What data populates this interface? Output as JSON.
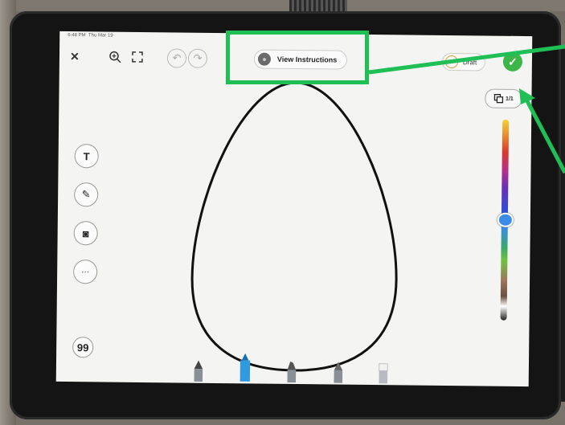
{
  "status_bar": {
    "time": "6:48 PM",
    "date": "Thu Mar 19"
  },
  "toolbar": {
    "instructions_label": "View Instructions",
    "draft_label": "Draft"
  },
  "page_indicator": "1/1",
  "side_tools": [
    {
      "icon": "text-icon",
      "glyph": "T"
    },
    {
      "icon": "pen-icon",
      "glyph": "✎"
    },
    {
      "icon": "camera-icon",
      "glyph": "◙"
    },
    {
      "icon": "more-icon",
      "glyph": "···"
    }
  ],
  "quote_glyph": "99",
  "colors": {
    "annotation_green": "#1fbf55",
    "done_green": "#3cb648",
    "selected_pen_blue": "#2f9ae0"
  },
  "canvas": {
    "shape": "egg-outline"
  },
  "palette_selected": "blue"
}
